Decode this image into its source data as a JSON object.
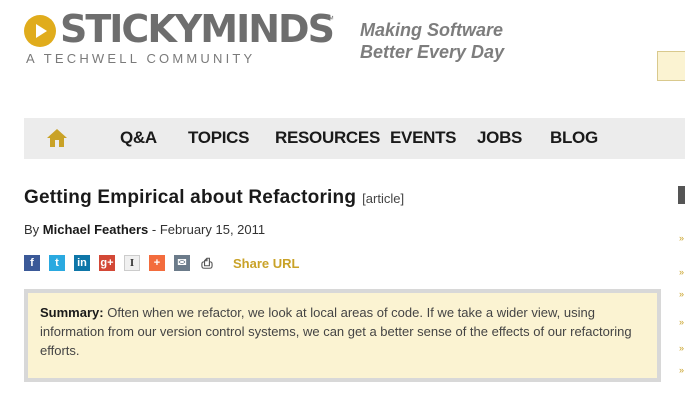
{
  "header": {
    "logo_text": "STICKYMINDS",
    "logo_tm": "™",
    "logo_subtitle": "A TECHWELL COMMUNITY",
    "tagline_line1": "Making Software",
    "tagline_line2": "Better Every Day"
  },
  "nav": {
    "items": [
      "Q&A",
      "TOPICS",
      "RESOURCES",
      "EVENTS",
      "JOBS",
      "BLOG"
    ]
  },
  "article": {
    "title": "Getting Empirical about Refactoring",
    "type_tag": "[article]",
    "by_label": "By",
    "author": "Michael Feathers",
    "date": "- February 15, 2011",
    "share_url_label": "Share URL",
    "summary_label": "Summary:",
    "summary_text": "Often when we refactor, we look at local areas of code. If we take a wider view, using information from our version control systems, we can get a better sense of the effects of our refactoring efforts."
  },
  "share_icons": [
    {
      "name": "facebook-icon",
      "glyph": "f",
      "color": "#3b5998"
    },
    {
      "name": "twitter-icon",
      "glyph": "t",
      "color": "#2aa9e0"
    },
    {
      "name": "linkedin-icon",
      "glyph": "in",
      "color": "#0e76a8"
    },
    {
      "name": "googleplus-icon",
      "glyph": "g+",
      "color": "#d34836"
    },
    {
      "name": "instapaper-icon",
      "glyph": "I",
      "color": "#f0f0f0"
    },
    {
      "name": "addthis-icon",
      "glyph": "+",
      "color": "#f36c3d"
    },
    {
      "name": "email-icon",
      "glyph": "✉",
      "color": "#6b7b8a"
    },
    {
      "name": "print-icon",
      "glyph": "⎙",
      "color": "#ffffff"
    }
  ],
  "colors": {
    "accent_gold": "#c9a227",
    "nav_bg": "#ececec",
    "summary_bg": "#fbf3d2"
  }
}
